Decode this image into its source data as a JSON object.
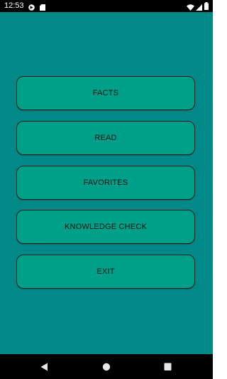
{
  "status_bar": {
    "time": "12:53",
    "left_icons": [
      "app-notification-icon",
      "sd-card-icon"
    ],
    "right_icons": [
      "wifi-icon",
      "cellular-signal-icon",
      "battery-icon"
    ]
  },
  "menu": {
    "buttons": [
      {
        "label": "FACTS"
      },
      {
        "label": "READ"
      },
      {
        "label": "FAVORITES"
      },
      {
        "label": "KNOWLEDGE CHECK"
      },
      {
        "label": "EXIT"
      }
    ]
  },
  "nav_bar": {
    "icons": [
      "back-icon",
      "home-icon",
      "recents-icon"
    ]
  },
  "colors": {
    "background": "#008986",
    "button": "#00a088",
    "button_border": "#1d1d1d",
    "bars": "#000000"
  }
}
